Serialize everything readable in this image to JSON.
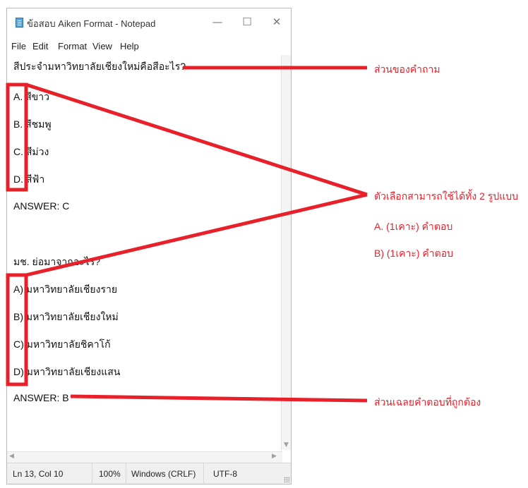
{
  "window": {
    "title": "ข้อสอบ Aiken Format - Notepad",
    "controls": {
      "minimize": "—",
      "maximize": "☐",
      "close": "✕"
    }
  },
  "menu": [
    "File",
    "Edit",
    "Format",
    "View",
    "Help"
  ],
  "editor": {
    "lines": [
      "สีประจำมหาวิทยาลัยเชียงใหม่คือสีอะไร?",
      "A. สีขาว",
      "B. สีชมพู",
      "C. สีม่วง",
      "D. สีฟ้า",
      "ANSWER: C",
      "",
      "มช. ย่อมาจากอะไร?",
      "A) มหาวิทยาลัยเชียงราย",
      "B) มหาวิทยาลัยเชียงใหม่",
      "C) มหาวิทยาลัยชิคาโก้",
      "D) มหาวิทยาลัยเชียงแสน",
      "ANSWER: B"
    ]
  },
  "status": {
    "position": "Ln 13, Col 10",
    "zoom": "100%",
    "line_ending": "Windows (CRLF)",
    "encoding": "UTF-8"
  },
  "annotations": {
    "question_part": "ส่วนของคำถาม",
    "choice_formats": "ตัวเลือกสามารถใช้ได้ทั้ง 2 รูปแบบ",
    "format_dot": "A. (1เคาะ) คำตอบ",
    "format_paren": "B) (1เคาะ) คำตอบ",
    "answer_part": "ส่วนเฉลยคำตอบที่ถูกต้อง"
  },
  "colors": {
    "annotation_red": "#e8202a"
  }
}
